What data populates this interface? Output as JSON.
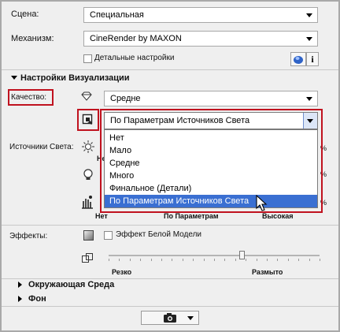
{
  "scene": {
    "label": "Сцена:",
    "value": "Специальная"
  },
  "engine": {
    "label": "Механизм:",
    "value": "CineRender by MAXON"
  },
  "detail_settings": {
    "label": "Детальные настройки"
  },
  "info_button": {
    "glyph": "i"
  },
  "visualization": {
    "title": "Настройки Визуализации"
  },
  "quality": {
    "label": "Качество:",
    "value": "Средне"
  },
  "light_quality": {
    "value": "По Параметрам Источников Света",
    "options": [
      "Нет",
      "Мало",
      "Средне",
      "Много",
      "Финальное (Детали)",
      "По Параметрам Источников Света"
    ],
    "selected_index": 5
  },
  "light_sources": {
    "label": "Источники Света:",
    "partial_left": "Не",
    "scale_labels": [
      "Нет",
      "По Параметрам",
      "Высокая"
    ],
    "percent_marks": [
      "%",
      "%",
      "%"
    ]
  },
  "effects": {
    "label": "Эффекты:",
    "white_model_label": "Эффект Белой Модели",
    "slider_left": "Резко",
    "slider_right": "Размыто",
    "slider_position": 0.63
  },
  "sections": {
    "environment": "Окружающая Среда",
    "background": "Фон"
  },
  "colors": {
    "highlight_box": "#c0121f",
    "selection": "#3a6fd2",
    "panel": "#efefef"
  },
  "icons": [
    "diamond-icon",
    "quality-mode-icon",
    "sun-icon",
    "bulb-icon",
    "hand-light-icon",
    "gradient-square-icon",
    "transform-icon",
    "camera-icon",
    "render-settings-icon",
    "info-icon",
    "mouse-cursor-icon"
  ]
}
